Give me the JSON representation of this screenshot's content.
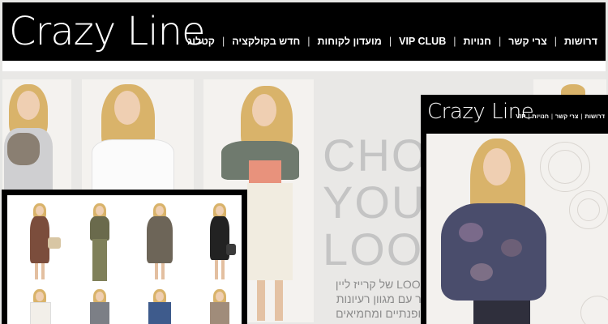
{
  "brand": {
    "logo_text": "Crazy Line",
    "text_color": "#ffffff",
    "header_bg": "#000000"
  },
  "header": {
    "nav": [
      {
        "label": "קטלוג"
      },
      {
        "label": "חדש בקולקציה"
      },
      {
        "label": "מועדון לקוחות"
      },
      {
        "label": "VIP CLUB"
      },
      {
        "label": "חנויות"
      },
      {
        "label": "צרי קשר"
      },
      {
        "label": "דרושות"
      }
    ],
    "separator": "|"
  },
  "hero": {
    "headline_lines": [
      "CHO",
      "YOU",
      "LOO"
    ],
    "hebrew_lines": [
      "LOOK של קרייז ליין",
      "קר עם מגוון רעיונות",
      "אופנתיים ומחמיאים"
    ]
  },
  "overlay_site": {
    "logo_text": "Crazy Line",
    "nav": [
      {
        "label": "VIP"
      },
      {
        "label": "חנויות"
      },
      {
        "label": "צרי קשר"
      },
      {
        "label": "דרושות"
      }
    ]
  },
  "icons": [
    "separator-bar"
  ]
}
